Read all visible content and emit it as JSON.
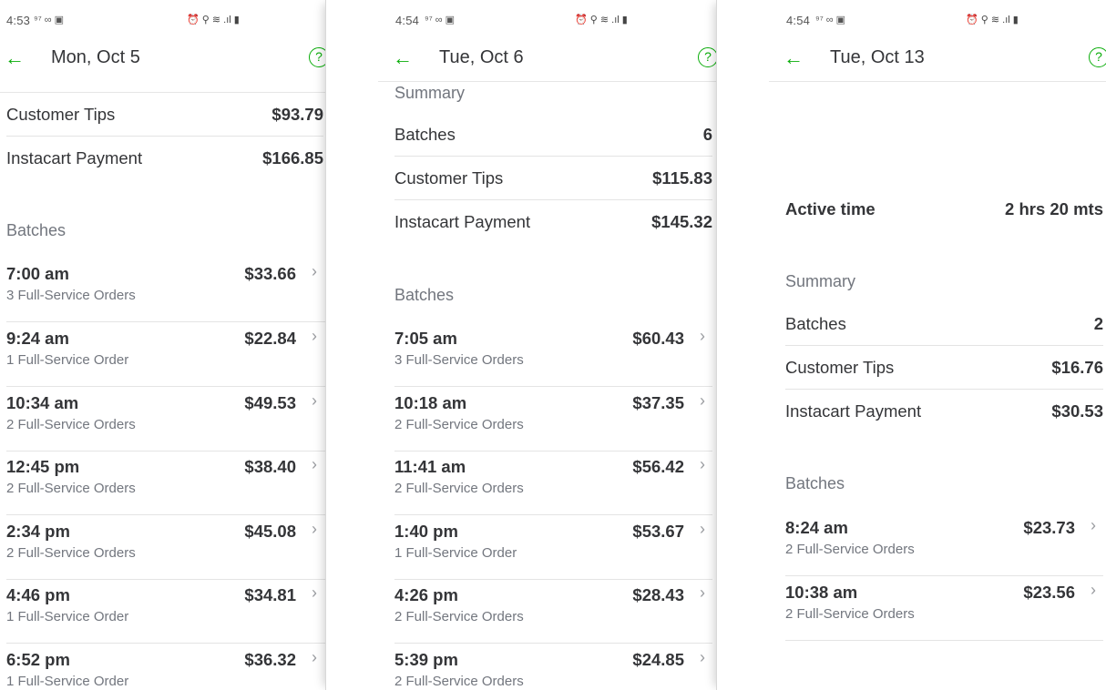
{
  "colors": {
    "accent": "#0aad0a",
    "text": "#343538",
    "muted": "#72767e",
    "divider": "#e4e4e4"
  },
  "icons": {
    "back": "arrow-left-icon",
    "help": "question-circle-icon",
    "chevron": "chevron-right-icon"
  },
  "panels": [
    {
      "status_time": "4:53",
      "status_left": "⁹⁷ ∞ ▣",
      "status_right": "⏰ ⚲ ≋ .ıl ▮",
      "title": "Mon, Oct 5",
      "back_glyph": "←",
      "help_glyph": "?",
      "summary_rows": [
        {
          "label": "Customer Tips",
          "value": "$93.79"
        },
        {
          "label": "Instacart Payment",
          "value": "$166.85"
        }
      ],
      "batches_heading": "Batches",
      "batches": [
        {
          "time": "7:00 am",
          "orders": "3 Full-Service Orders",
          "amount": "$33.66"
        },
        {
          "time": "9:24 am",
          "orders": "1 Full-Service Order",
          "amount": "$22.84"
        },
        {
          "time": "10:34 am",
          "orders": "2 Full-Service Orders",
          "amount": "$49.53"
        },
        {
          "time": "12:45 pm",
          "orders": "2 Full-Service Orders",
          "amount": "$38.40"
        },
        {
          "time": "2:34 pm",
          "orders": "2 Full-Service Orders",
          "amount": "$45.08"
        },
        {
          "time": "4:46 pm",
          "orders": "1 Full-Service Order",
          "amount": "$34.81"
        },
        {
          "time": "6:52 pm",
          "orders": "1 Full-Service Order",
          "amount": "$36.32"
        }
      ]
    },
    {
      "status_time": "4:54",
      "status_left": "⁹⁷ ∞ ▣",
      "status_right": "⏰ ⚲ ≋ .ıl ▮",
      "title": "Tue, Oct 6",
      "back_glyph": "←",
      "help_glyph": "?",
      "summary_heading": "Summary",
      "summary_rows": [
        {
          "label": "Batches",
          "value": "6"
        },
        {
          "label": "Customer Tips",
          "value": "$115.83"
        },
        {
          "label": "Instacart Payment",
          "value": "$145.32"
        }
      ],
      "batches_heading": "Batches",
      "batches": [
        {
          "time": "7:05 am",
          "orders": "3 Full-Service Orders",
          "amount": "$60.43"
        },
        {
          "time": "10:18 am",
          "orders": "2 Full-Service Orders",
          "amount": "$37.35"
        },
        {
          "time": "11:41 am",
          "orders": "2 Full-Service Orders",
          "amount": "$56.42"
        },
        {
          "time": "1:40 pm",
          "orders": "1 Full-Service Order",
          "amount": "$53.67"
        },
        {
          "time": "4:26 pm",
          "orders": "2 Full-Service Orders",
          "amount": "$28.43"
        },
        {
          "time": "5:39 pm",
          "orders": "2 Full-Service Orders",
          "amount": "$24.85"
        }
      ]
    },
    {
      "status_time": "4:54",
      "status_left": "⁹⁷ ∞ ▣",
      "status_right": "⏰ ⚲ ≋ .ıl ▮",
      "title": "Tue, Oct 13",
      "back_glyph": "←",
      "help_glyph": "?",
      "active_time": {
        "label": "Active time",
        "value": "2 hrs 20 mts"
      },
      "summary_heading": "Summary",
      "summary_rows": [
        {
          "label": "Batches",
          "value": "2"
        },
        {
          "label": "Customer Tips",
          "value": "$16.76"
        },
        {
          "label": "Instacart Payment",
          "value": "$30.53"
        }
      ],
      "batches_heading": "Batches",
      "batches": [
        {
          "time": "8:24 am",
          "orders": "2 Full-Service Orders",
          "amount": "$23.73"
        },
        {
          "time": "10:38 am",
          "orders": "2 Full-Service Orders",
          "amount": "$23.56"
        }
      ],
      "chevron_glyph": "›"
    }
  ]
}
